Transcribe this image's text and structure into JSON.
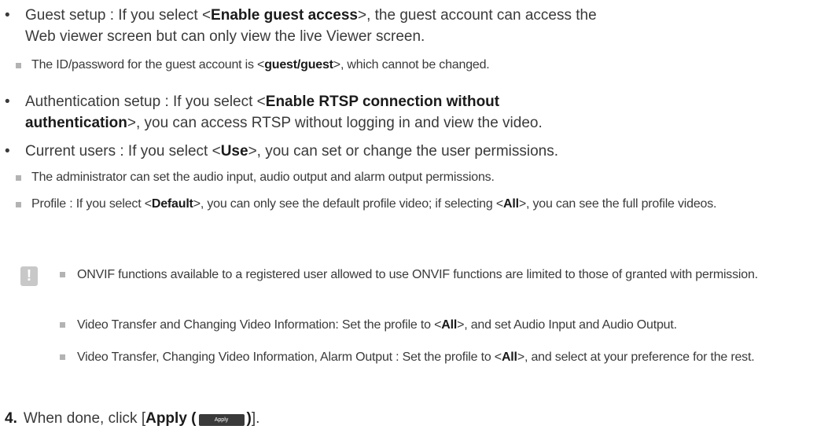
{
  "bullets": [
    {
      "pre": "Guest setup : If you select <",
      "bold": "Enable guest access",
      "post": ">, the guest account can access the Web viewer screen but can only view the live Viewer screen."
    },
    {
      "pre": "Authentication setup : If you select <",
      "bold": "Enable RTSP connection without authentication",
      "post": ">, you can access RTSP without logging in and view the video."
    },
    {
      "pre": "Current users : If you select <",
      "bold": "Use",
      "post": ">, you can set or change the user permissions."
    }
  ],
  "sub_notes": {
    "guest_id": {
      "pre": "The ID/password for the guest account is <",
      "bold": "guest/guest",
      "post": ">, which cannot be changed."
    },
    "administrator": {
      "text": "The administrator can set the audio input, audio output and alarm output permissions."
    },
    "profile": {
      "pre": "Profile : If you select <",
      "bold": "Default",
      "mid": ">, you can only see the default profile video; if selecting <",
      "bold2": "All",
      "post": ">, you can see the full profile videos."
    }
  },
  "warning_icon": "exclamation-icon",
  "warning_glyph": "!",
  "warnings": [
    {
      "pre": "ONVIF functions available to a registered user allowed to use ONVIF functions are limited to those of granted with permission."
    },
    {
      "pre": "Video Transfer and Changing Video Information: Set the profile to <",
      "bold": "All",
      "post": ">, and set Audio Input and Audio Output."
    },
    {
      "pre": "Video Transfer, Changing Video Information, Alarm Output : Set the profile to <",
      "bold": "All",
      "post": ">, and select at your preference for the rest."
    }
  ],
  "step": {
    "number": "4.",
    "pre": "When done, click [",
    "bold": "Apply (",
    "button_label": "Apply",
    "bold_close": ")",
    "post": "]."
  }
}
